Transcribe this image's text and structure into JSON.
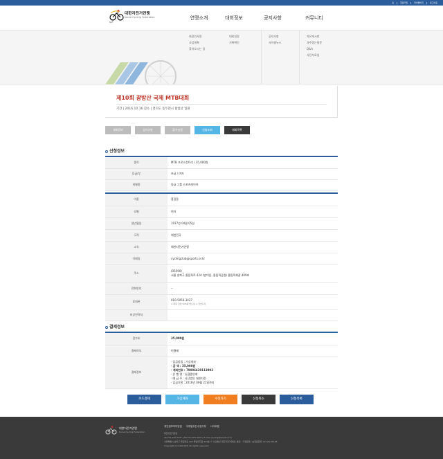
{
  "toplinks": [
    "홈",
    "회원가입",
    "마이페이지",
    "로그아웃"
  ],
  "logo": {
    "name": "대한자전거연맹",
    "en": "Korea Cycling Federation",
    "abbr": "KCF"
  },
  "nav": [
    "연맹소개",
    "대회정보",
    "공지사항",
    "커뮤니티"
  ],
  "mega_menu": {
    "col1": [
      "회장인사말",
      "사업계획",
      "찾아오시는 길"
    ],
    "col2": [
      "대회일정",
      "기록확인"
    ],
    "col3": [
      "공지사항",
      "사이클뉴스"
    ],
    "col4": [
      "자유게시판",
      "자주묻는질문",
      "Q&A",
      "사진자료실"
    ]
  },
  "event": {
    "title": "제10회 광방산 국제 MTB대회",
    "meta": "기간 | 2016.10.16   장소 | 경기도 동두천시 왕방산 일원"
  },
  "tabs": [
    "대회정보",
    "공지사항",
    "참가신청",
    "신청조회",
    "대회목록"
  ],
  "sections": {
    "apply": "신청정보",
    "payment": "결제정보"
  },
  "event_rows": [
    {
      "label": "종목",
      "value": "MTB 크로스컨트리 / 35,000원"
    },
    {
      "label": "등급/부",
      "value": "초급 / 여자"
    },
    {
      "label": "개별종",
      "value": "동급 그룹 스포츠레이어"
    }
  ],
  "person_rows": [
    {
      "label": "이름",
      "value": "홍길동"
    },
    {
      "label": "성별",
      "value": "여자"
    },
    {
      "label": "생년월일",
      "value": "1977년 04월 05일"
    },
    {
      "label": "국적",
      "value": "대한민국"
    },
    {
      "label": "소속",
      "value": "대한자전거연맹"
    },
    {
      "label": "이메일",
      "value": "cyclingclub@sports.or.kr"
    },
    {
      "label": "주소",
      "value": "(05590)",
      "value2": "서울 송파구 올림픽로 424 (방이동, 올림픽공원) 올림픽회관 409호"
    },
    {
      "label": "전화번호",
      "value": "--"
    },
    {
      "label": "휴대폰",
      "value": "010-5056-3437",
      "note": "※ 대회 관련 SMS를 받으실 수 있습니다"
    },
    {
      "label": "비상연락처",
      "value": ""
    }
  ],
  "payment_rows": [
    {
      "label": "참가비",
      "value": "35,000원"
    },
    {
      "label": "결제여부",
      "value": "미결제"
    }
  ],
  "payment_info": {
    "label": "결제정보",
    "lines": [
      "· 입금방법 : 가상계좌",
      "· 금 액 : 35,000원",
      "· 계좌번호 : 79006420113992",
      "· 은 행 명 : 농협중앙회",
      "· 예 금 주 : 사단법인 대한자전",
      "· 입금기한 : 2016년 09월 21일까지"
    ]
  },
  "actions": [
    {
      "label": "카드결제",
      "color": "#2b5d9c"
    },
    {
      "label": "가상계좌",
      "color": "#55b5e4"
    },
    {
      "label": "수정하기",
      "color": "#f07d20"
    },
    {
      "label": "신청취소",
      "color": "#3a3a3a"
    },
    {
      "label": "신청목록",
      "color": "#2b5d9c"
    }
  ],
  "footer": {
    "logo_name": "대한자전거연맹",
    "logo_en": "Korea Cycling Federation",
    "links": [
      "개인정보처리방침",
      "이메일무단수집거부",
      "사이트맵"
    ],
    "info": [
      "대한자전거연맹",
      "TEL 02-420-4247 | FAX 02-420-4270 | E-mail cycling@sports.or.kr",
      "서울특별시 송파구 올림픽로 424 올림픽회관 409호 © 사단법인 대한자전거연맹 | 통장 : 기업은행 / 농협중앙회 124-09-95128",
      "Copyright (c) 2016 KCF. All rights reserved."
    ]
  }
}
